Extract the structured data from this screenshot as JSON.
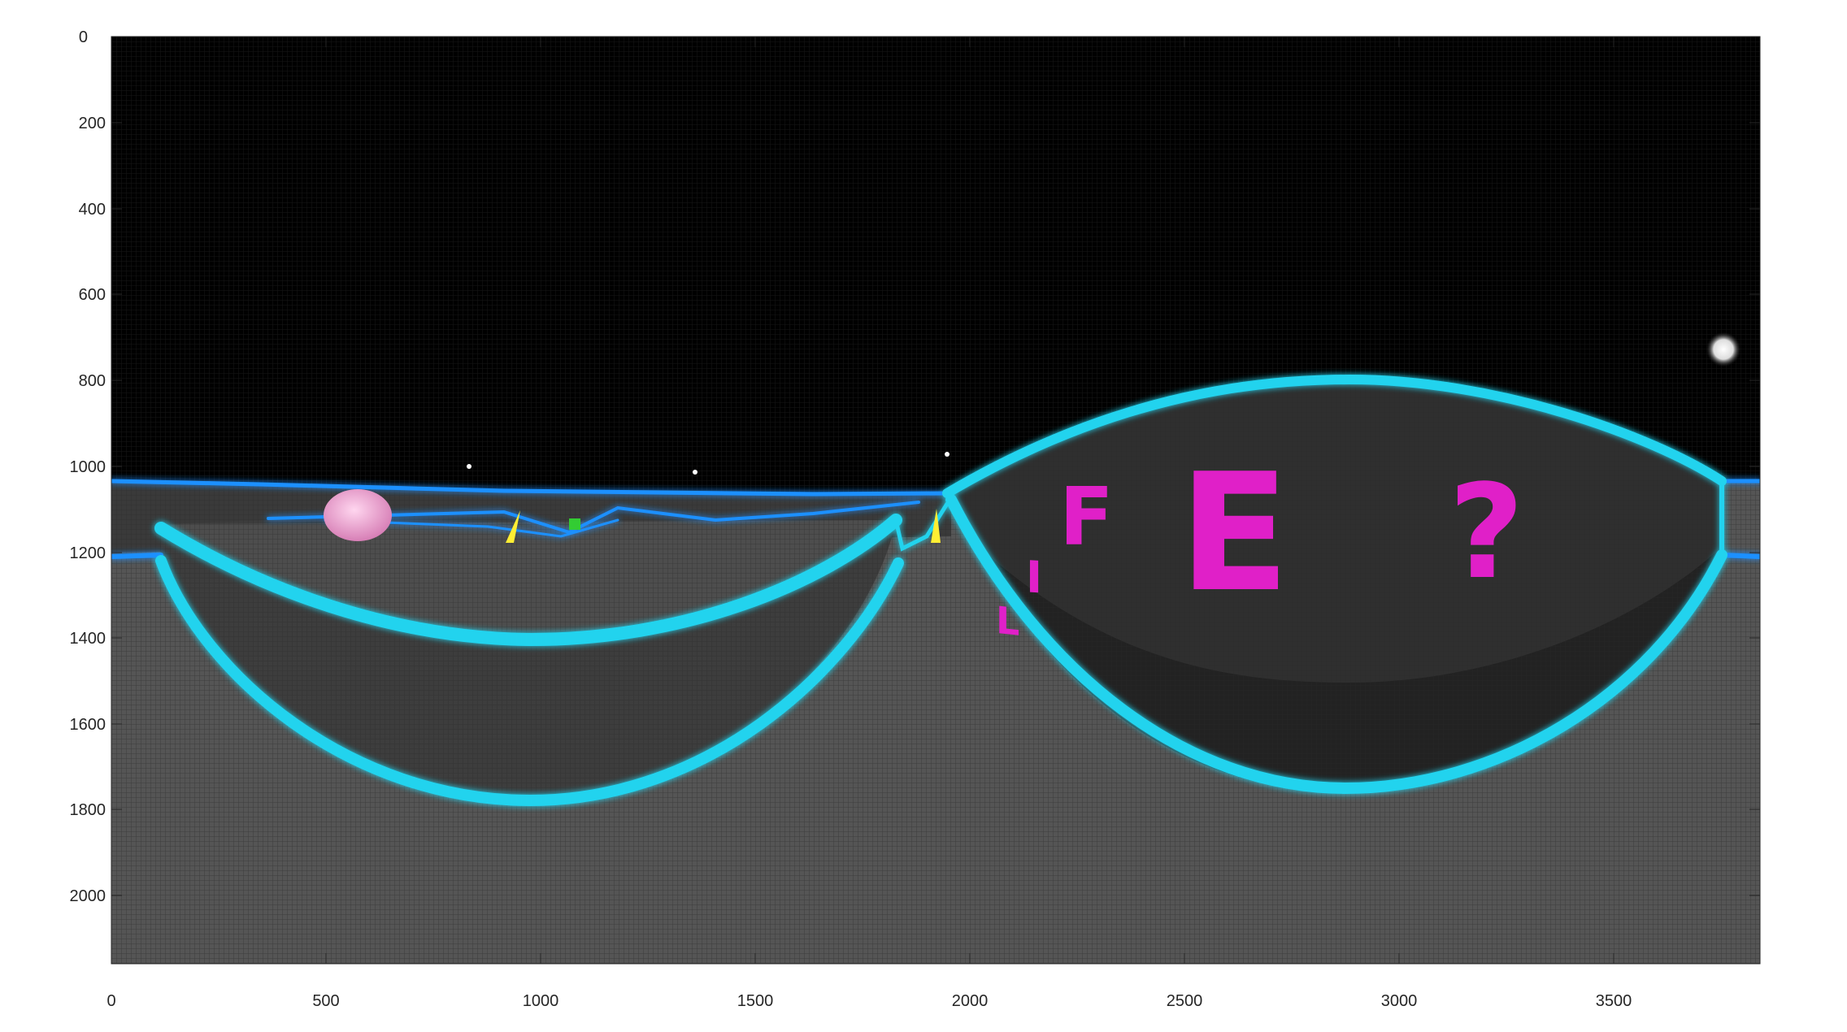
{
  "figure": {
    "image_semantics": "equirectangular-panorama-neon-track",
    "x_ticks": [
      "0",
      "500",
      "1000",
      "1500",
      "2000",
      "2500",
      "3000",
      "3500"
    ],
    "y_ticks": [
      "0",
      "200",
      "400",
      "600",
      "800",
      "1000",
      "1200",
      "1400",
      "1600",
      "1800",
      "2000"
    ],
    "xlim": [
      0,
      3840
    ],
    "ylim": [
      0,
      2160
    ],
    "scene_letters": [
      "L",
      "I",
      "F",
      "E",
      "?"
    ],
    "colors": {
      "sky": "#000000",
      "ground": "#555555",
      "grid_line": "#2a2a2a",
      "neon_edge": "#22d3ee",
      "neon_glow": "#1e90ff",
      "letters": "#e020c8",
      "bowl": "#3a3a3a",
      "pink_ball": "#f3a7d8",
      "yellow_cone": "#ffee33",
      "green_marker": "#33cc33"
    }
  }
}
